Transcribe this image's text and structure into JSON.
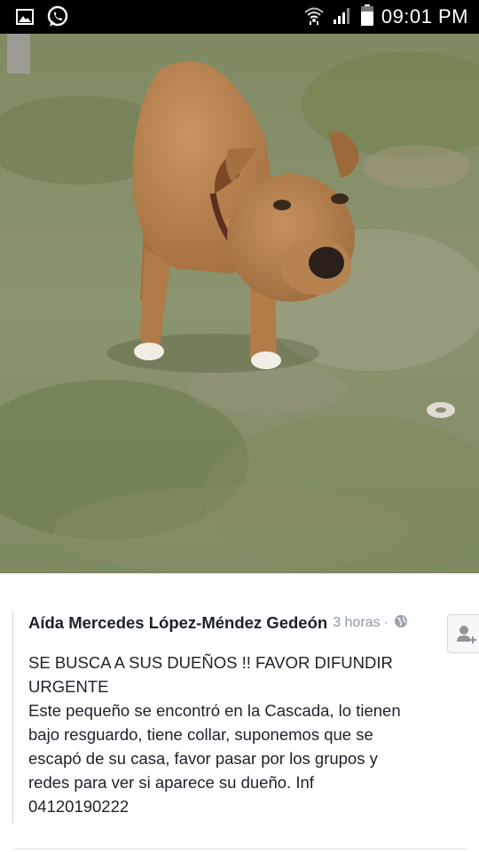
{
  "status_bar": {
    "time": "09:01 PM",
    "icons": [
      "gallery-icon",
      "whatsapp-icon",
      "wifi-icon",
      "signal-icon",
      "battery-icon"
    ]
  },
  "photo": {
    "subject": "dog-photo"
  },
  "post": {
    "author": "Aída Mercedes López-Méndez Gedeón",
    "time_ago": "3 horas",
    "separator": "·",
    "lines": [
      "SE BUSCA A SUS DUEÑOS !! FAVOR DIFUNDIR",
      "URGENTE",
      "Este pequeño se encontró en la Cascada, lo tienen",
      "bajo resguardo, tiene collar, suponemos que se",
      "escapó de su casa, favor pasar por los grupos y",
      "redes para ver si aparece su dueño. Inf",
      "04120190222"
    ]
  },
  "colors": {
    "status_bar_bg": "#000000",
    "text_primary": "#1d2129",
    "text_secondary": "#8d949e"
  }
}
